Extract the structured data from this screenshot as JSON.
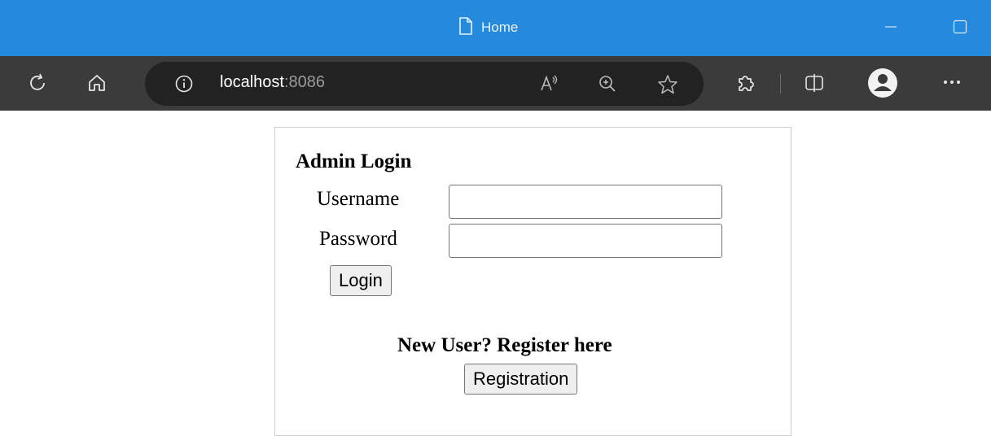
{
  "window": {
    "title": "Home",
    "colors": {
      "titlebar": "#2589dc",
      "toolbar": "#3b3b3b",
      "addressbar": "#222222"
    }
  },
  "browser": {
    "url_host": "localhost",
    "url_port": ":8086",
    "icons": [
      "refresh-icon",
      "home-icon",
      "info-icon",
      "read-aloud-icon",
      "zoom-icon",
      "favorite-star-icon",
      "extensions-icon",
      "split-screen-icon",
      "profile-icon",
      "more-icon"
    ]
  },
  "login": {
    "heading": "Admin Login",
    "username_label": "Username",
    "username_value": "",
    "password_label": "Password",
    "password_value": "",
    "login_button": "Login"
  },
  "register": {
    "heading": "New User? Register here",
    "button": "Registration"
  }
}
